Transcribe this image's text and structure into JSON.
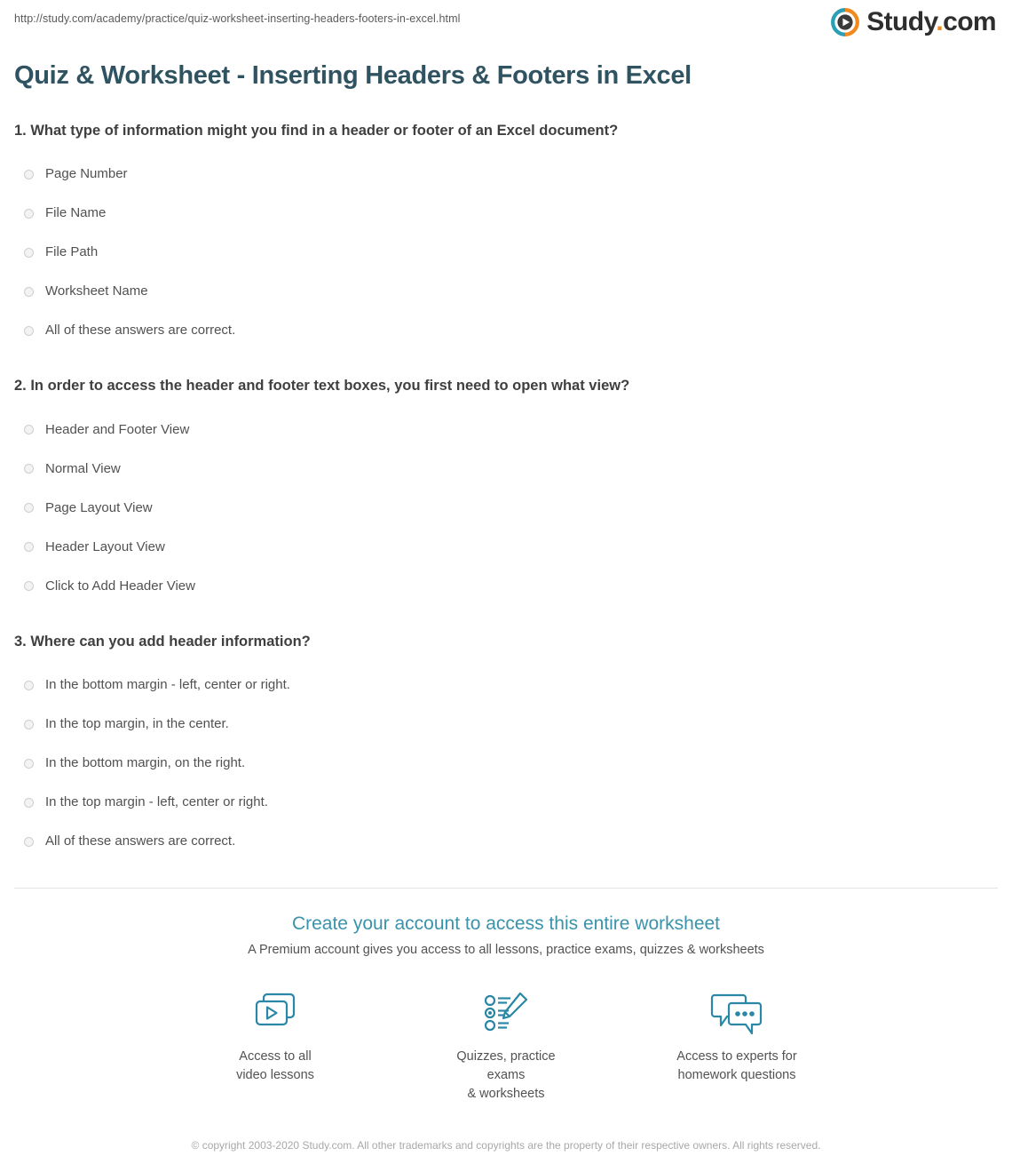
{
  "browser": {
    "url": "http://study.com/academy/practice/quiz-worksheet-inserting-headers-footers-in-excel.html"
  },
  "brand": {
    "name": "Study",
    "suffix": "com",
    "dot": ".",
    "logo_icon": "play-circle-icon",
    "accent_orange": "#f08a1e",
    "accent_teal": "#2a9fb5"
  },
  "header": {
    "title": "Quiz & Worksheet - Inserting Headers & Footers in Excel",
    "title_color": "#2f5360"
  },
  "quiz": {
    "questions": [
      {
        "number": "1.",
        "text": "1. What type of information might you find in a header or footer of an Excel document?",
        "options": [
          "Page Number",
          "File Name",
          "File Path",
          "Worksheet Name",
          "All of these answers are correct."
        ]
      },
      {
        "number": "2.",
        "text": "2. In order to access the header and footer text boxes, you first need to open what view?",
        "options": [
          "Header and Footer View",
          "Normal View",
          "Page Layout View",
          "Header Layout View",
          "Click to Add Header View"
        ]
      },
      {
        "number": "3.",
        "text": "3. Where can you add header information?",
        "options": [
          "In the bottom margin - left, center or right.",
          "In the top margin, in the center.",
          "In the bottom margin, on the right.",
          "In the top margin - left, center or right.",
          "All of these answers are correct."
        ]
      }
    ]
  },
  "cta": {
    "title": "Create your account to access this entire worksheet",
    "subtitle": "A Premium account gives you access to all lessons, practice exams, quizzes & worksheets",
    "title_color": "#3a93ab",
    "features": [
      {
        "icon": "video-lessons-icon",
        "label": "Access to all\nvideo lessons"
      },
      {
        "icon": "quiz-pencil-icon",
        "label": "Quizzes, practice exams\n& worksheets"
      },
      {
        "icon": "chat-bubbles-icon",
        "label": "Access to experts for\nhomework questions"
      }
    ]
  },
  "footer": {
    "copyright": "© copyright 2003-2020 Study.com. All other trademarks and copyrights are the property of their respective owners. All rights reserved."
  }
}
